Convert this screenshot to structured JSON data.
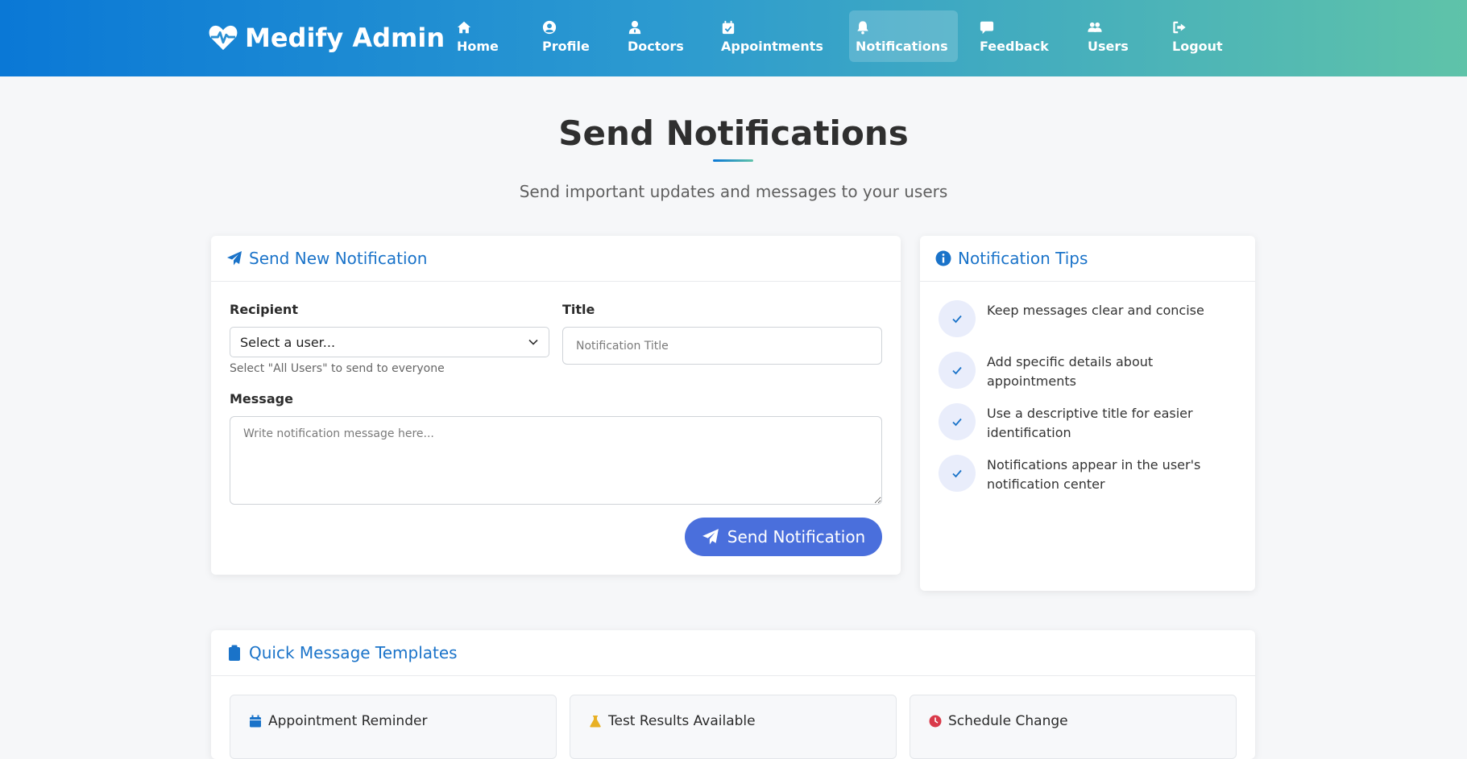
{
  "nav": {
    "brand": "Medify Admin",
    "items": [
      {
        "label": "Home",
        "icon": "home-icon"
      },
      {
        "label": "Profile",
        "icon": "user-circle-icon"
      },
      {
        "label": "Doctors",
        "icon": "doctor-icon"
      },
      {
        "label": "Appointments",
        "icon": "calendar-check-icon"
      },
      {
        "label": "Notifications",
        "icon": "bell-icon",
        "active": true
      },
      {
        "label": "Feedback",
        "icon": "comment-icon"
      },
      {
        "label": "Users",
        "icon": "users-icon"
      },
      {
        "label": "Logout",
        "icon": "logout-icon"
      }
    ]
  },
  "header": {
    "title": "Send Notifications",
    "subtitle": "Send important updates and messages to your users"
  },
  "send_form": {
    "heading": "Send New Notification",
    "recipient_label": "Recipient",
    "recipient_value": "Select a user...",
    "recipient_help": "Select \"All Users\" to send to everyone",
    "title_label": "Title",
    "title_placeholder": "Notification Title",
    "message_label": "Message",
    "message_placeholder": "Write notification message here...",
    "send_label": "Send Notification"
  },
  "tips": {
    "heading": "Notification Tips",
    "items": [
      "Keep messages clear and concise",
      "Add specific details about appointments",
      "Use a descriptive title for easier identification",
      "Notifications appear in the user's notification center"
    ]
  },
  "templates": {
    "heading": "Quick Message Templates",
    "items": [
      {
        "label": "Appointment Reminder",
        "icon": "calendar-icon",
        "color": "#1a73c9"
      },
      {
        "label": "Test Results Available",
        "icon": "flask-icon",
        "color": "#e8b024"
      },
      {
        "label": "Schedule Change",
        "icon": "clock-icon",
        "color": "#d93a4a"
      }
    ]
  },
  "colors": {
    "accent": "#1a73c9",
    "button": "#4a6fdc",
    "nav_gradient_start": "#0a78d6",
    "nav_gradient_end": "#5fc3a9"
  }
}
